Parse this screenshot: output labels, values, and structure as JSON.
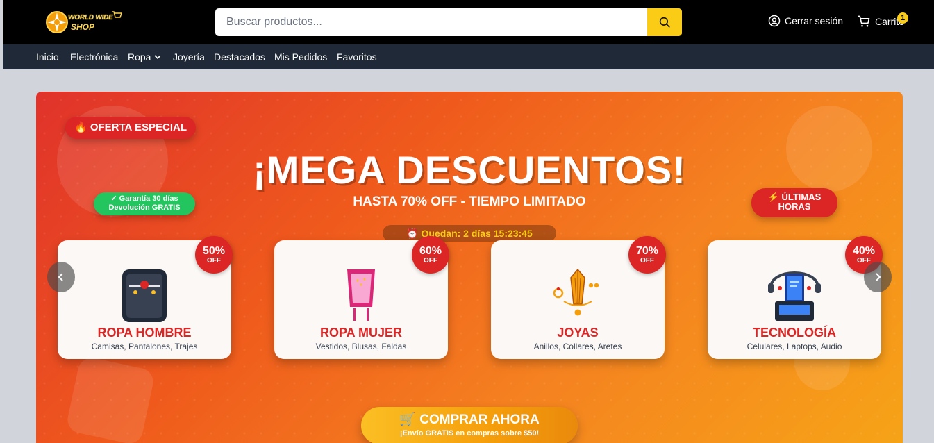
{
  "header": {
    "logo_line1": "WORLD WIDE",
    "logo_line2": "SHOP",
    "search_placeholder": "Buscar productos...",
    "logout_label": "Cerrar sesión",
    "cart_label": "Carrito",
    "cart_count": "1",
    "search_icon": "search-icon",
    "user_icon": "user-icon",
    "cart_icon": "cart-icon"
  },
  "nav": {
    "items": [
      "Inicio",
      "Electrónica",
      "Ropa",
      "Joyería",
      "Destacados",
      "Mis Pedidos",
      "Favoritos"
    ]
  },
  "banner": {
    "offer_badge": "OFERTA ESPECIAL",
    "guarantee_line1": "✓ Garantía 30 días",
    "guarantee_line2": "Devolución GRATIS",
    "last_hours_line1": "ÚLTIMAS",
    "last_hours_line2": "HORAS",
    "headline": "¡MEGA DESCUENTOS!",
    "subheadline": "HASTA 70% OFF - TIEMPO LIMITADO",
    "countdown": "Quedan: 2 días 15:23:45",
    "cards": [
      {
        "discount": "50%",
        "off": "OFF",
        "title": "ROPA HOMBRE",
        "subtitle": "Camisas, Pantalones, Trajes",
        "icon": "men-clothing-icon"
      },
      {
        "discount": "60%",
        "off": "OFF",
        "title": "ROPA MUJER",
        "subtitle": "Vestidos, Blusas, Faldas",
        "icon": "women-clothing-icon"
      },
      {
        "discount": "70%",
        "off": "OFF",
        "title": "JOYAS",
        "subtitle": "Anillos, Collares, Aretes",
        "icon": "jewelry-icon"
      },
      {
        "discount": "40%",
        "off": "OFF",
        "title": "TECNOLOGÍA",
        "subtitle": "Celulares, Laptops, Audio",
        "icon": "technology-icon"
      }
    ],
    "cta_main": "COMPRAR AHORA",
    "cta_sub": "¡Envío GRATIS en compras sobre $50!"
  },
  "colors": {
    "accent": "#facc15",
    "header_bg": "#000000",
    "nav_bg": "#1f2937",
    "badge_red": "#dc2626",
    "guarantee_green": "#22c55e"
  }
}
